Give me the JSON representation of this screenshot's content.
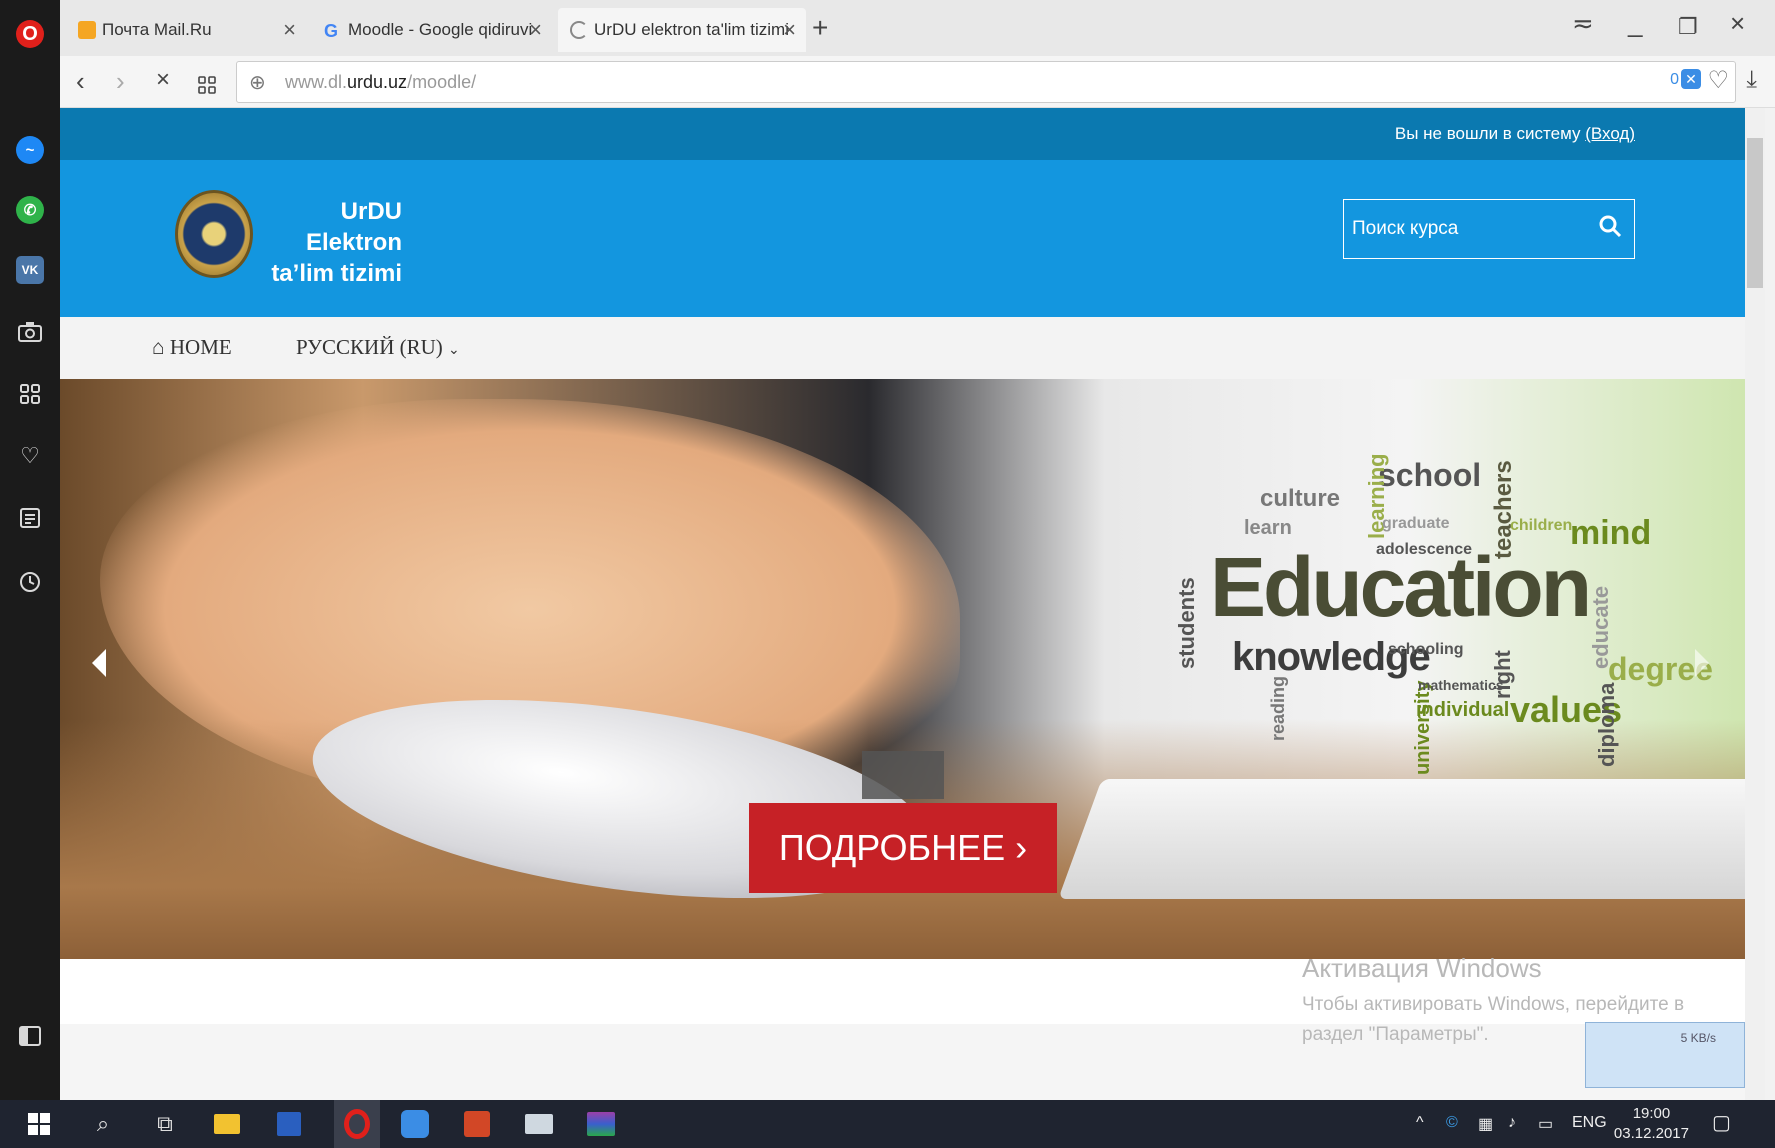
{
  "browser": {
    "tabs": [
      {
        "label": "Почта Mail.Ru"
      },
      {
        "label": "Moodle - Google qidiruvi"
      },
      {
        "label": "UrDU elektron ta'lim tizimi"
      }
    ],
    "new_tab": "+",
    "url_prefix": "www.dl.",
    "url_domain": "urdu.uz",
    "url_path": "/moodle/",
    "adblock_count": "0"
  },
  "page": {
    "login_text": "Вы не вошли в систему",
    "login_link": "(Вход)",
    "brand_line1": "UrDU",
    "brand_line2": "Elektron",
    "brand_line3": "ta’lim tizimi",
    "search_placeholder": "Поиск курса",
    "nav": {
      "home": "HOME",
      "language": "РУССКИЙ (RU)"
    },
    "hero": {
      "button": "ПОДРОБНЕЕ ›",
      "wordcloud": [
        "Education",
        "knowledge",
        "school",
        "culture",
        "teachers",
        "mind",
        "values",
        "degree",
        "students",
        "university",
        "learning",
        "educate",
        "diploma",
        "learn",
        "children",
        "adolescence",
        "graduate",
        "reading",
        "schooling",
        "individual",
        "mathematics",
        "right"
      ]
    },
    "activation_title": "Активация Windows",
    "activation_line1": "Чтобы активировать Windows, перейдите в",
    "activation_line2": "раздел \"Параметры\"."
  },
  "netmeter": "5 KB/s",
  "taskbar": {
    "lang": "ENG",
    "time": "19:00",
    "date": "03.12.2017"
  },
  "colors": {
    "topstrip": "#0b79b0",
    "header": "#1396df",
    "cta": "#c62126",
    "sidebar": "#1b1b1b"
  }
}
